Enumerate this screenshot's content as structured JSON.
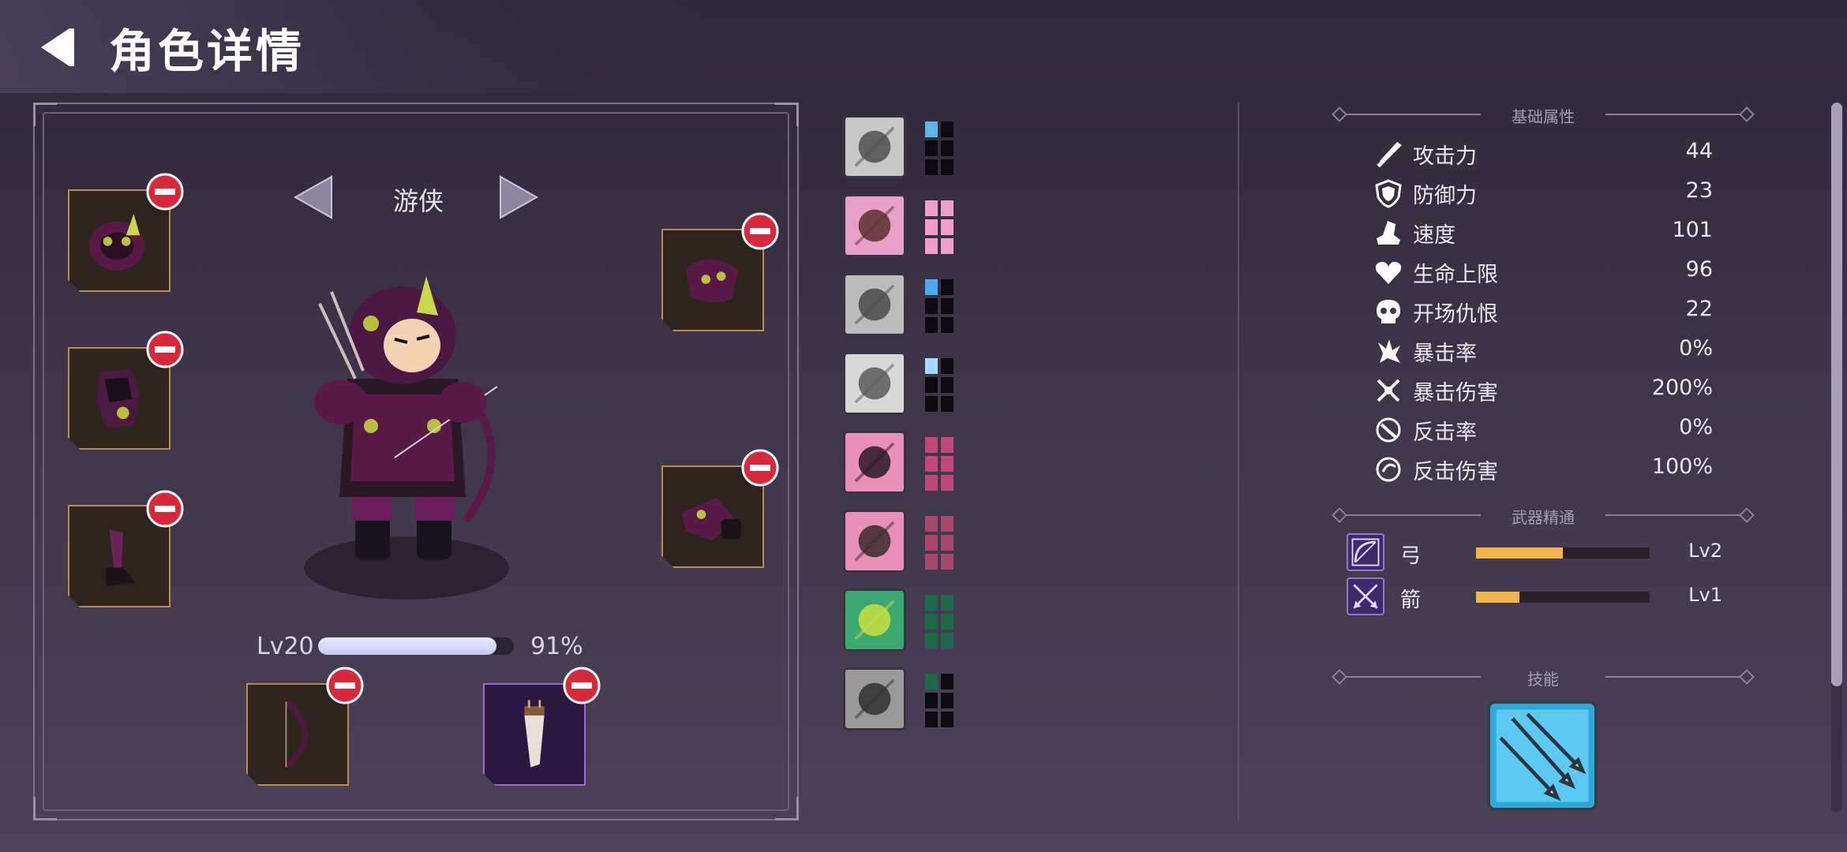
{
  "header": {
    "title": "角色详情"
  },
  "character": {
    "class_name": "游侠",
    "level_label": "Lv20",
    "xp_percent_label": "91%",
    "xp_fraction": 0.91
  },
  "equipment": {
    "slots": [
      {
        "name": "helmet"
      },
      {
        "name": "armor"
      },
      {
        "name": "boots"
      },
      {
        "name": "shoulder"
      },
      {
        "name": "gloves"
      },
      {
        "name": "bow"
      },
      {
        "name": "quiver"
      }
    ]
  },
  "gems": [
    {
      "icon": "ogre-rune-icon",
      "pip_color": "#5ab8e8",
      "filled": 1
    },
    {
      "icon": "boot-rune-icon",
      "pip_color": "#f0a0c8",
      "filled": 6
    },
    {
      "icon": "bone-rune-icon",
      "pip_color": "#4aa8f0",
      "filled": 1
    },
    {
      "icon": "spirit-rune-icon",
      "pip_color": "#a8d8f8",
      "filled": 1
    },
    {
      "icon": "claw-rune-icon",
      "pip_color": "#c04878",
      "filled": 6
    },
    {
      "icon": "cross-blade-rune-icon",
      "pip_color": "#a84868",
      "filled": 6
    },
    {
      "icon": "poison-rune-icon",
      "pip_color": "#1e6a48",
      "filled": 6
    },
    {
      "icon": "gate-rune-icon",
      "pip_color": "#1e6a48",
      "filled": 1
    }
  ],
  "stats": {
    "section_label": "基础属性",
    "items": [
      {
        "icon": "sword-icon",
        "name": "攻击力",
        "value": "44"
      },
      {
        "icon": "shield-icon",
        "name": "防御力",
        "value": "23"
      },
      {
        "icon": "boot-icon",
        "name": "速度",
        "value": "101"
      },
      {
        "icon": "heart-icon",
        "name": "生命上限",
        "value": "96"
      },
      {
        "icon": "skull-icon",
        "name": "开场仇恨",
        "value": "22"
      },
      {
        "icon": "crit-icon",
        "name": "暴击率",
        "value": "0%"
      },
      {
        "icon": "crit-damage-icon",
        "name": "暴击伤害",
        "value": "200%"
      },
      {
        "icon": "counter-icon",
        "name": "反击率",
        "value": "0%"
      },
      {
        "icon": "counter-damage-icon",
        "name": "反击伤害",
        "value": "100%"
      }
    ]
  },
  "mastery": {
    "section_label": "武器精通",
    "items": [
      {
        "icon": "bow-mastery-icon",
        "name": "弓",
        "level": "Lv2",
        "progress": 0.5
      },
      {
        "icon": "arrow-mastery-icon",
        "name": "箭",
        "level": "Lv1",
        "progress": 0.25
      }
    ]
  },
  "skills": {
    "section_label": "技能",
    "items": [
      {
        "icon": "multi-arrow-skill-icon"
      }
    ]
  },
  "colors": {
    "accent_gold": "#f2b54a",
    "slot_border": "#b48e5a",
    "remove_red": "#d8283a"
  }
}
